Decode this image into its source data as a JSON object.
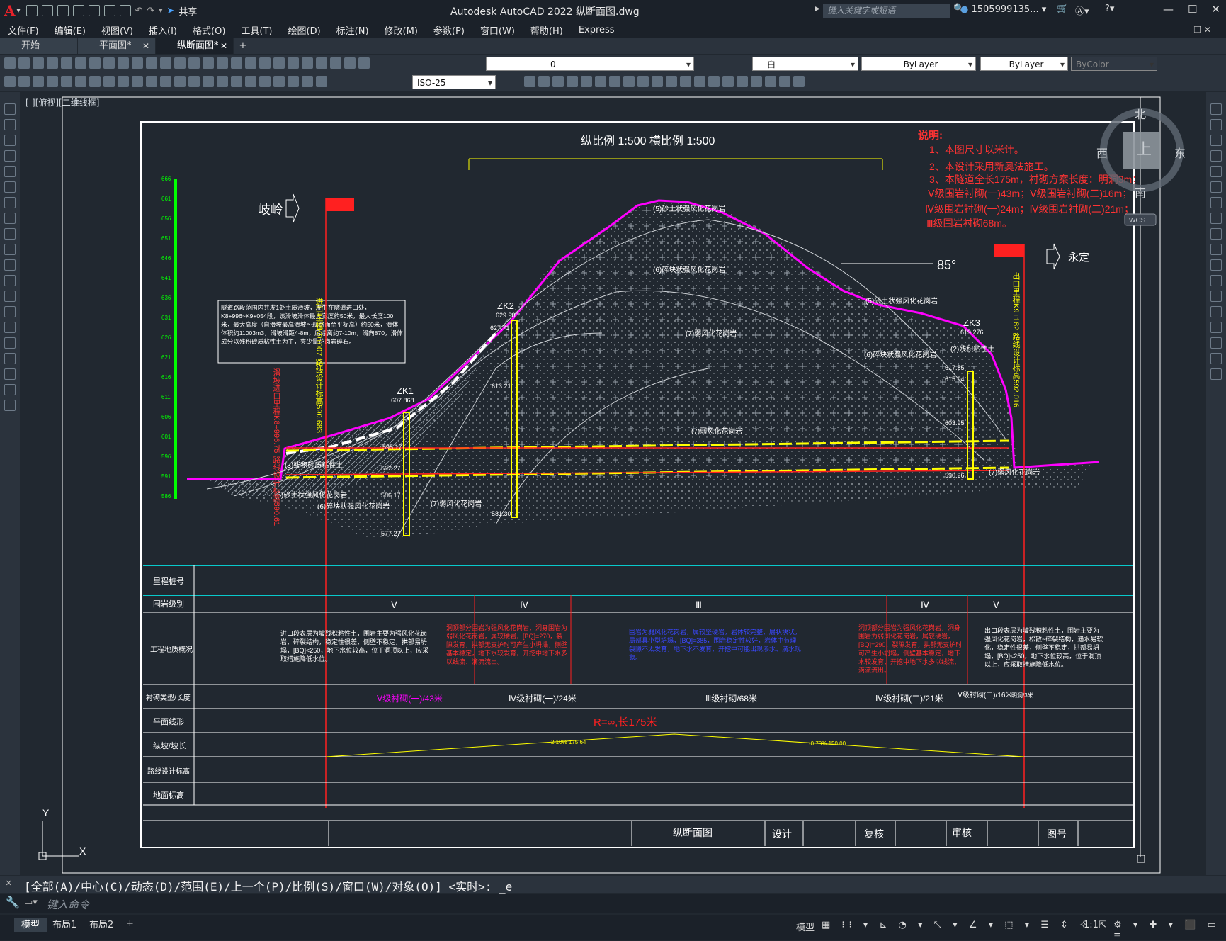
{
  "app": {
    "title": "Autodesk AutoCAD 2022    纵断面图.dwg",
    "search_placeholder": "键入关键字或短语",
    "user": "1505999135...",
    "share": "共享"
  },
  "menu": [
    "文件(F)",
    "编辑(E)",
    "视图(V)",
    "插入(I)",
    "格式(O)",
    "工具(T)",
    "绘图(D)",
    "标注(N)",
    "修改(M)",
    "参数(P)",
    "窗口(W)",
    "帮助(H)",
    "Express"
  ],
  "tabs": [
    {
      "label": "开始"
    },
    {
      "label": "平面图*"
    },
    {
      "label": "纵断面图*"
    }
  ],
  "toolbar": {
    "layer": "0",
    "color": "白",
    "linetype": "ByLayer",
    "lineweight": "ByLayer",
    "plotstyle": "ByColor",
    "dimstyle": "ISO-25"
  },
  "viewport_label": "[-][俯视][二维线框]",
  "viewcube": {
    "north": "北",
    "south": "南",
    "east": "东",
    "west": "西",
    "top": "上",
    "wcs": "WCS"
  },
  "drawing": {
    "scale_text": "纵比例  1:500     横比例  1:500",
    "entrance_arrow": "岐岭",
    "exit_arrow": "永定",
    "angle": "85°",
    "notes_title": "说明:",
    "notes": [
      "1、本图尺寸以米计。",
      "2、本设计采用新奥法施工。",
      "3、本隧道全长175m，衬砌方案长度：明洞3m；",
      "Ⅴ级围岩衬砌(一)43m；Ⅴ级围岩衬砌(二)16m；",
      "Ⅳ级围岩衬砌(一)24m；Ⅳ级围岩衬砌(二)21m；",
      "Ⅲ级围岩衬砌68m。"
    ],
    "landslide_note": "隧道路段范围内共发1处土质滑坡，发生在隧道进口处，K8+996~K9+054段，该滑坡滑体最大宽度约50米，最大长度100米，最大高度（自滑坡最高滑坡～现路面至平标高）约50米，滑体体积约11003m3，滑坡滑距4-8m，后缘离约7-10m，滑向870，滑体成分以残积砂质粘性土为主，夹少量花岗岩碎石。",
    "boreholes": [
      {
        "name": "ZK1",
        "elev": "607.868"
      },
      {
        "name": "ZK2",
        "elev": "629.900"
      },
      {
        "name": "ZK3",
        "elev": "619.276"
      }
    ],
    "elev_labels": [
      "595.17",
      "592.27",
      "586.17",
      "577.27",
      "627.71",
      "613.21",
      "581.30",
      "617.85",
      "615.04",
      "603.95",
      "590.96"
    ],
    "strata": [
      "(5)砂土状强风化花岗岩",
      "(6)碎块状强风化花岗岩",
      "(7)弱风化花岗岩",
      "(3)残积砂质粘性土",
      "(2)残积粘性土"
    ],
    "entrance_mark": "进口里程K9+007  路线设计标高590.683",
    "exit_mark": "出口里程K9+182  路线设计标高592.016",
    "slide_mark": "滑坡进口里程K8+996.75 路线设计标高590.61",
    "axis_ticks": [
      "666",
      "661",
      "656",
      "651",
      "646",
      "641",
      "636",
      "631",
      "626",
      "621",
      "616",
      "611",
      "606",
      "601",
      "596",
      "591",
      "586"
    ],
    "table_rows": [
      "里程桩号",
      "围岩级别",
      "工程地质概况",
      "衬砌类型/长度",
      "平面线形",
      "纵坡/坡长",
      "路线设计标高",
      "地面标高"
    ],
    "rock_grades": [
      "Ⅴ",
      "Ⅳ",
      "Ⅲ",
      "Ⅳ",
      "Ⅴ"
    ],
    "geology_texts": [
      "进口段表层为坡残积粘性土，围岩主要为强风化花岗岩，碎裂结构，稳定性很差，侧壁不稳定，拱部易坍塌，[BQ]<250，地下水位较高，位于洞顶以上，应采取措施降低水位。",
      "洞顶部分围岩为强风化花岗岩，洞身围岩为弱风化花岗岩，属较硬岩，[BQ]=270，裂隙发育，拱部无支护时可产生小坍塌，侧壁基本稳定，地下水较发育，开挖中地下水多以线流、滴流流出。",
      "围岩为弱风化花岗岩，属较坚硬岩，岩体较完整，层状块状，局部具小型坍塌，[BQ]=385，围岩稳定性较好，岩体中节理裂隙不太发育，地下水不发育，开挖中可能出现渗水、滴水现象。",
      "洞顶部分围岩为强风化花岗岩，洞身围岩为弱风化花岗岩，属较硬岩，[BQ]=290，裂隙发育，拱部无支护时可产生小坍塌，侧壁基本稳定，地下水较发育，开挖中地下水多以线流、滴流流出。",
      "出口段表层为坡残积粘性土，围岩主要为强风化花岗岩，松散~碎裂结构，遇水易软化，稳定性很差，侧壁不稳定，拱部易坍塌，[BQ]<250，地下水位较高，位于洞顶以上，应采取措施降低水位。"
    ],
    "lining": [
      "Ⅴ级衬砌(一)/43米",
      "Ⅳ级衬砌(一)/24米",
      "Ⅲ级衬砌/68米",
      "Ⅳ级衬砌(二)/21米",
      "Ⅴ级衬砌(二)/16米",
      "明洞/3米"
    ],
    "plane_alignment": "R=∞,长175米",
    "grade1": "2.10%\n175.64",
    "grade2": "-0.70%\n150.00",
    "titleblock": [
      "纵断面图",
      "设计",
      "复核",
      "审核",
      "图号"
    ]
  },
  "command": {
    "history": "[全部(A)/中心(C)/动态(D)/范围(E)/上一个(P)/比例(S)/窗口(W)/对象(O)] <实时>: _e",
    "placeholder": "键入命令"
  },
  "status": {
    "layouts": [
      "模型",
      "布局1",
      "布局2"
    ],
    "model": "模型",
    "scale": "1:1"
  }
}
